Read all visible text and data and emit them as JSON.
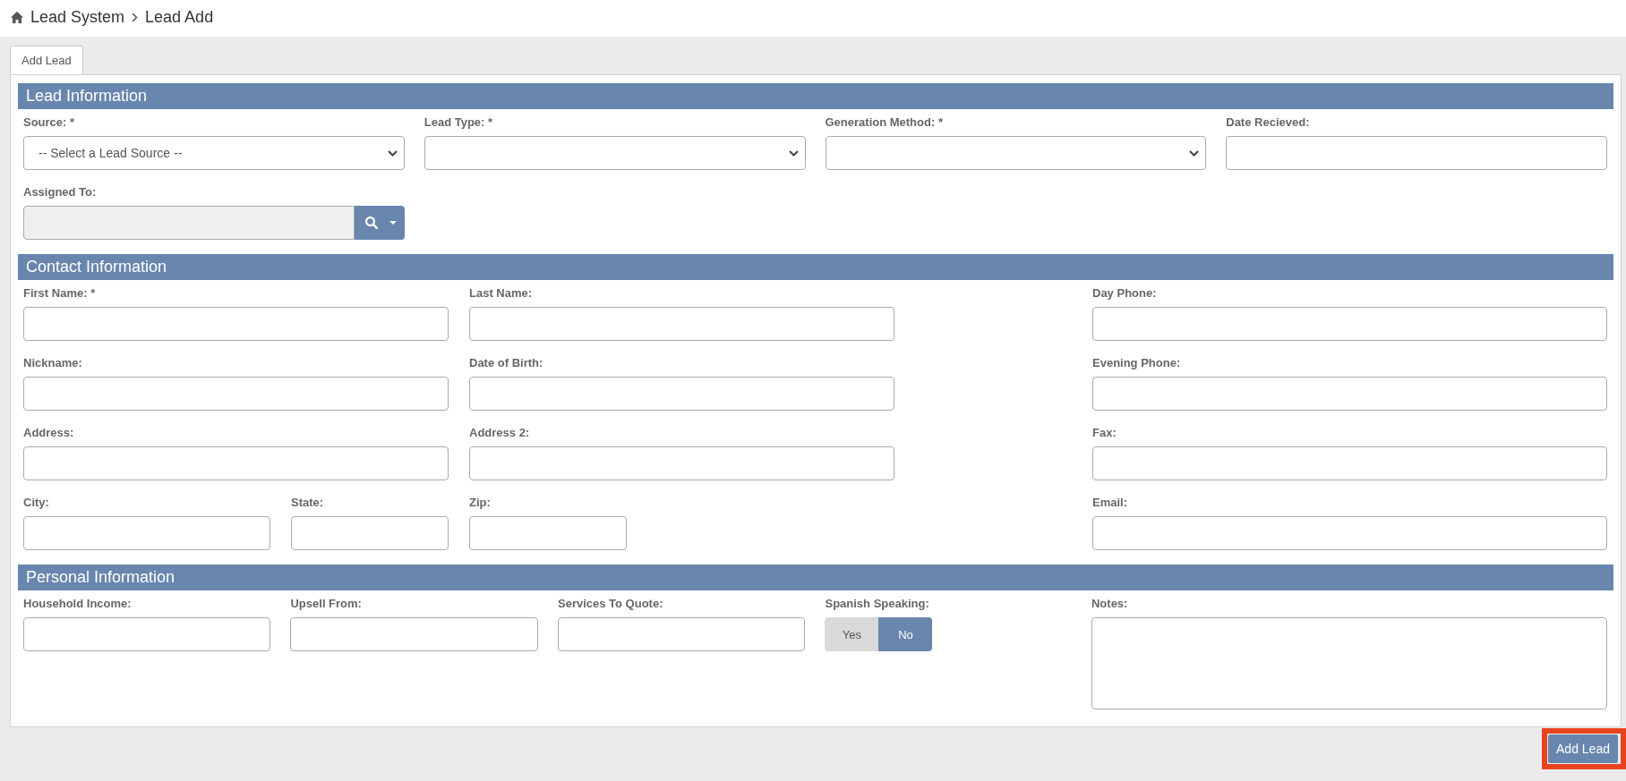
{
  "breadcrumb": [
    {
      "label": "Lead System"
    },
    {
      "label": "Lead Add"
    }
  ],
  "tabs": [
    {
      "label": "Add Lead",
      "selected": true
    }
  ],
  "sections": [
    {
      "title": "Lead Information",
      "rows": [
        {
          "fields": [
            {
              "kind": "select",
              "label": "Source: *",
              "value": "-- Select a Lead Source --"
            },
            {
              "kind": "select",
              "label": "Lead Type: *"
            },
            {
              "kind": "select",
              "label": "Generation Method: *"
            },
            {
              "kind": "text",
              "label": "Date Recieved:"
            }
          ]
        },
        {
          "fields": [
            {
              "kind": "lookup",
              "label": "Assigned To:",
              "disabled": true
            }
          ]
        }
      ]
    },
    {
      "title": "Contact Information",
      "rows": [
        {
          "fields": [
            {
              "kind": "text",
              "label": "First Name: *"
            },
            {
              "kind": "text",
              "label": "Last Name:"
            },
            {
              "kind": "text",
              "label": "Day Phone:"
            }
          ]
        },
        {
          "fields": [
            {
              "kind": "text",
              "label": "Nickname:"
            },
            {
              "kind": "text",
              "label": "Date of Birth:"
            },
            {
              "kind": "text",
              "label": "Evening Phone:"
            }
          ]
        },
        {
          "fields": [
            {
              "kind": "text",
              "label": "Address:"
            },
            {
              "kind": "text",
              "label": "Address 2:"
            },
            {
              "kind": "text",
              "label": "Fax:"
            }
          ]
        },
        {
          "fields": [
            {
              "kind": "text",
              "label": "City:"
            },
            {
              "kind": "text",
              "label": "State:"
            },
            {
              "kind": "text",
              "label": "Zip:"
            },
            {
              "kind": "text",
              "label": "Email:"
            }
          ]
        }
      ]
    },
    {
      "title": "Personal Information",
      "rows": [
        {
          "fields": [
            {
              "kind": "text",
              "label": "Household Income:"
            },
            {
              "kind": "text",
              "label": "Upsell From:"
            },
            {
              "kind": "text",
              "label": "Services To Quote:"
            },
            {
              "kind": "toggle",
              "label": "Spanish Speaking:",
              "options": [
                {
                  "label": "Yes",
                  "selected": false
                },
                {
                  "label": "No",
                  "selected": true
                }
              ]
            },
            {
              "kind": "textarea",
              "label": "Notes:"
            }
          ]
        }
      ]
    }
  ],
  "submit_button": {
    "label": "Add Lead",
    "highlighted": true
  }
}
